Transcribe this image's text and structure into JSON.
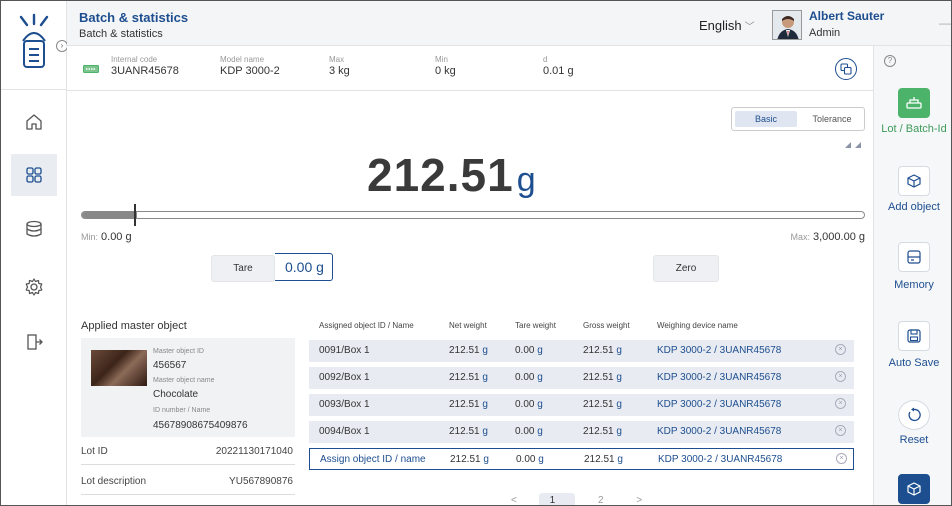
{
  "header": {
    "title": "Batch & statistics",
    "subtitle": "Batch & statistics",
    "language": "English",
    "user_name": "Albert Sauter",
    "user_role": "Admin"
  },
  "info": {
    "internal_code_label": "Internal code",
    "internal_code": "3UANR45678",
    "model_label": "Model name",
    "model": "KDP 3000-2",
    "max_label": "Max",
    "max": "3 kg",
    "min_label": "Min",
    "min": "0 kg",
    "d_label": "d",
    "d": "0.01 g"
  },
  "mode": {
    "basic": "Basic",
    "tolerance": "Tolerance",
    "selected": "Basic"
  },
  "weighing": {
    "value": "212.51",
    "unit": "g",
    "min_label": "Min:",
    "min_value": "0.00 g",
    "max_label": "Max:",
    "max_value": "3,000.00 g",
    "fill_fraction": 0.07,
    "tare_label": "Tare",
    "tare_value": "0.00",
    "tare_unit": "g",
    "zero_label": "Zero"
  },
  "master": {
    "title": "Applied master object",
    "id_label": "Master object ID",
    "id": "456567",
    "name_label": "Master object name",
    "name": "Chocolate",
    "idnum_label": "ID number / Name",
    "idnum": "456789086754098​76",
    "lot_id_label": "Lot ID",
    "lot_id": "20221130171040",
    "lot_desc_label": "Lot description",
    "lot_desc": "YU567890876"
  },
  "table": {
    "headers": [
      "Assigned object ID / Name",
      "Net weight",
      "Tare weight",
      "Gross weight",
      "Weighing device name"
    ],
    "rows": [
      {
        "id": "0091/Box 1",
        "net": "212.51",
        "tare": "0.00",
        "gross": "212.51",
        "device": "KDP 3000-2 / 3UANR45678"
      },
      {
        "id": "0092/Box 1",
        "net": "212.51",
        "tare": "0.00",
        "gross": "212.51",
        "device": "KDP 3000-2 / 3UANR45678"
      },
      {
        "id": "0093/Box 1",
        "net": "212.51",
        "tare": "0.00",
        "gross": "212.51",
        "device": "KDP 3000-2 / 3UANR45678"
      },
      {
        "id": "0094/Box 1",
        "net": "212.51",
        "tare": "0.00",
        "gross": "212.51",
        "device": "KDP 3000-2 / 3UANR45678"
      }
    ],
    "assign_row": {
      "id": "Assign object ID / name",
      "net": "212.51",
      "tare": "0.00",
      "gross": "212.51",
      "device": "KDP 3000-2 / 3UANR45678"
    },
    "unit": "g",
    "pagination": {
      "prev": "<",
      "page1": "1",
      "page2": "2",
      "next": ">"
    }
  },
  "rightbar": {
    "lot": "Lot / Batch-Id",
    "add_object": "Add object",
    "memory": "Memory",
    "auto_save": "Auto Save",
    "reset": "Reset"
  },
  "colors": {
    "brand": "#1d4e8f",
    "green": "#4cb36a"
  }
}
